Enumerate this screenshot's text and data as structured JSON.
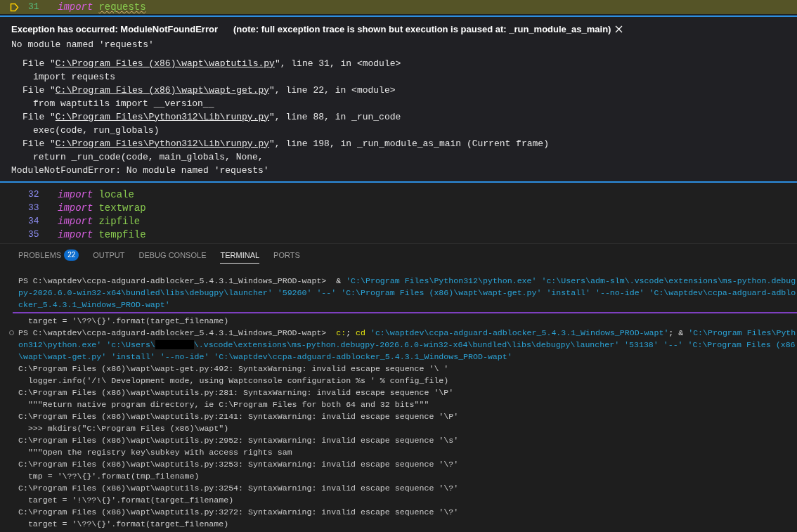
{
  "editor": {
    "current_line": {
      "number": "31",
      "paused": true,
      "tokens": [
        {
          "text": "import",
          "kind": "keyword",
          "warning": false
        },
        {
          "text": "requests",
          "kind": "name",
          "warning": true
        }
      ]
    },
    "exception": {
      "title": "Exception has occurred: ModuleNotFoundError",
      "note": "(note: full exception trace is shown but execution is paused at: _run_module_as_main)",
      "message": "No module named 'requests'",
      "trace": [
        {
          "kind": "file",
          "before": "File \"",
          "path": "C:\\Program Files (x86)\\wapt\\waptutils.py",
          "after": "\", line 31, in <module>"
        },
        {
          "kind": "code",
          "text": "import requests"
        },
        {
          "kind": "file",
          "before": "File \"",
          "path": "C:\\Program Files (x86)\\wapt\\wapt-get.py",
          "after": "\", line 22, in <module>"
        },
        {
          "kind": "code",
          "text": "from waptutils import __version__"
        },
        {
          "kind": "file",
          "before": "File \"",
          "path": "C:\\Program Files\\Python312\\Lib\\runpy.py",
          "after": "\", line 88, in _run_code"
        },
        {
          "kind": "code",
          "text": "exec(code, run_globals)"
        },
        {
          "kind": "file",
          "before": "File \"",
          "path": "C:\\Program Files\\Python312\\Lib\\runpy.py",
          "after": "\", line 198, in _run_module_as_main (Current frame)"
        },
        {
          "kind": "code",
          "text": "return _run_code(code, main_globals, None,"
        }
      ],
      "final": "ModuleNotFoundError: No module named 'requests'"
    },
    "lines": [
      {
        "number": "32",
        "tokens": [
          {
            "text": "import",
            "kind": "keyword",
            "warning": false
          },
          {
            "text": "locale",
            "kind": "name",
            "warning": false
          }
        ]
      },
      {
        "number": "33",
        "tokens": [
          {
            "text": "import",
            "kind": "keyword",
            "warning": false
          },
          {
            "text": "textwrap",
            "kind": "name",
            "warning": false
          }
        ]
      },
      {
        "number": "34",
        "tokens": [
          {
            "text": "import",
            "kind": "keyword",
            "warning": false
          },
          {
            "text": "zipfile",
            "kind": "name",
            "warning": false
          }
        ]
      },
      {
        "number": "35",
        "tokens": [
          {
            "text": "import",
            "kind": "keyword",
            "warning": false
          },
          {
            "text": "tempfile",
            "kind": "name",
            "warning": false
          }
        ]
      }
    ]
  },
  "panel": {
    "tabs": [
      {
        "label": "PROBLEMS",
        "badge": "22",
        "selected": false
      },
      {
        "label": "OUTPUT",
        "selected": false
      },
      {
        "label": "DEBUG CONSOLE",
        "selected": false
      },
      {
        "label": "TERMINAL",
        "selected": true
      },
      {
        "label": "PORTS",
        "selected": false
      }
    ],
    "terminal": [
      {
        "kind": "text",
        "marker": false,
        "segments": [
          {
            "kind": "prompt",
            "text": "PS C:\\waptdev\\ccpa-adguard-adblocker_5.4.3.1_Windows_PROD-wapt>  "
          },
          {
            "kind": "op",
            "text": "& "
          },
          {
            "kind": "arg",
            "text": "'C:\\Program Files\\Python312\\python.exe' 'c:\\Users\\adm-slm\\.vscode\\extensions\\ms-python.debug"
          }
        ]
      },
      {
        "kind": "text",
        "marker": false,
        "segments": [
          {
            "kind": "arg",
            "text": "py-2026.6.0-win32-x64\\bundled\\libs\\debugpy\\launcher' '59260' '--' 'C:\\Program Files (x86)\\wapt\\wapt-get.py' 'install' '--no-ide' 'C:\\waptdev\\ccpa-adguard-adblo"
          }
        ]
      },
      {
        "kind": "text",
        "marker": false,
        "segments": [
          {
            "kind": "arg",
            "text": "cker_5.4.3.1_Windows_PROD-wapt'"
          }
        ]
      },
      {
        "kind": "divider"
      },
      {
        "kind": "text",
        "marker": false,
        "segments": [
          {
            "kind": "output",
            "text": "  target = '\\??\\{}'.format(target_filename)"
          }
        ]
      },
      {
        "kind": "text",
        "marker": true,
        "segments": [
          {
            "kind": "prompt",
            "text": "PS C:\\waptdev\\ccpa-adguard-adblocker_5.4.3.1_Windows_PROD-wapt>  "
          },
          {
            "kind": "cmd",
            "text": "c:"
          },
          {
            "kind": "op",
            "text": "; "
          },
          {
            "kind": "cmd",
            "text": "cd "
          },
          {
            "kind": "arg",
            "text": "'c:\\waptdev\\ccpa-adguard-adblocker_5.4.3.1_Windows_PROD-wapt'"
          },
          {
            "kind": "op",
            "text": "; & "
          },
          {
            "kind": "arg",
            "text": "'C:\\Program Files\\Pyth"
          }
        ]
      },
      {
        "kind": "text",
        "marker": false,
        "segments": [
          {
            "kind": "arg",
            "text": "on312\\python.exe' 'c:\\Users\\"
          },
          {
            "kind": "redacted"
          },
          {
            "kind": "arg",
            "text": "\\.vscode\\extensions\\ms-python.debugpy-2026.6.0-win32-x64\\bundled\\libs\\debugpy\\launcher' '53138' '--' 'C:\\Program Files (x86"
          }
        ]
      },
      {
        "kind": "text",
        "marker": false,
        "segments": [
          {
            "kind": "arg",
            "text": "\\wapt\\wapt-get.py' 'install' '--no-ide' 'C:\\waptdev\\ccpa-adguard-adblocker_5.4.3.1_Windows_PROD-wapt'"
          }
        ]
      },
      {
        "kind": "text",
        "marker": false,
        "segments": [
          {
            "kind": "output",
            "text": "C:\\Program Files (x86)\\wapt\\wapt-get.py:492: SyntaxWarning: invalid escape sequence '\\ '"
          }
        ]
      },
      {
        "kind": "text",
        "marker": false,
        "segments": [
          {
            "kind": "output",
            "text": "  logger.info('/!\\ Development mode, using Waptconsole configuration %s ' % config_file)"
          }
        ]
      },
      {
        "kind": "text",
        "marker": false,
        "segments": [
          {
            "kind": "output",
            "text": "C:\\Program Files (x86)\\wapt\\waptutils.py:281: SyntaxWarning: invalid escape sequence '\\P'"
          }
        ]
      },
      {
        "kind": "text",
        "marker": false,
        "segments": [
          {
            "kind": "output",
            "text": "  \"\"\"Return native program directory, ie C:\\Program Files for both 64 and 32 bits\"\"\""
          }
        ]
      },
      {
        "kind": "text",
        "marker": false,
        "segments": [
          {
            "kind": "output",
            "text": "C:\\Program Files (x86)\\wapt\\waptutils.py:2141: SyntaxWarning: invalid escape sequence '\\P'"
          }
        ]
      },
      {
        "kind": "text",
        "marker": false,
        "segments": [
          {
            "kind": "output",
            "text": "  >>> mkdirs(\"C:\\Program Files (x86)\\wapt\")"
          }
        ]
      },
      {
        "kind": "text",
        "marker": false,
        "segments": [
          {
            "kind": "output",
            "text": "C:\\Program Files (x86)\\wapt\\waptutils.py:2952: SyntaxWarning: invalid escape sequence '\\s'"
          }
        ]
      },
      {
        "kind": "text",
        "marker": false,
        "segments": [
          {
            "kind": "output",
            "text": "  \"\"\"Open the registry key\\subkey with access rights sam"
          }
        ]
      },
      {
        "kind": "text",
        "marker": false,
        "segments": [
          {
            "kind": "output",
            "text": "C:\\Program Files (x86)\\wapt\\waptutils.py:3253: SyntaxWarning: invalid escape sequence '\\?'"
          }
        ]
      },
      {
        "kind": "text",
        "marker": false,
        "segments": [
          {
            "kind": "output",
            "text": "  tmp = '\\??\\{}'.format(tmp_filename)"
          }
        ]
      },
      {
        "kind": "text",
        "marker": false,
        "segments": [
          {
            "kind": "output",
            "text": "C:\\Program Files (x86)\\wapt\\waptutils.py:3254: SyntaxWarning: invalid escape sequence '\\?'"
          }
        ]
      },
      {
        "kind": "text",
        "marker": false,
        "segments": [
          {
            "kind": "output",
            "text": "  target = '!\\??\\{}'.format(target_filename)"
          }
        ]
      },
      {
        "kind": "text",
        "marker": false,
        "segments": [
          {
            "kind": "output",
            "text": "C:\\Program Files (x86)\\wapt\\waptutils.py:3272: SyntaxWarning: invalid escape sequence '\\?'"
          }
        ]
      },
      {
        "kind": "text",
        "marker": false,
        "segments": [
          {
            "kind": "output",
            "text": "  target = '\\??\\{}'.format(target_filename)"
          }
        ]
      }
    ]
  }
}
